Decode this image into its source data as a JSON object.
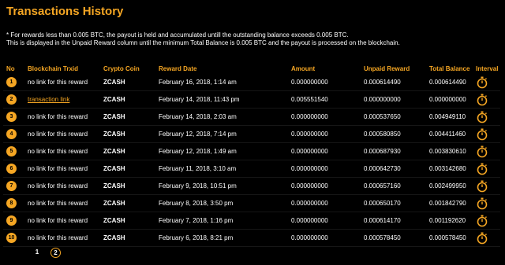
{
  "title": "Transactions History",
  "note": {
    "line1": "* For rewards less than 0.005 BTC, the payout is held and accumulated untill the outstanding balance exceeds 0.005 BTC.",
    "line2": "This is displayed in the Unpaid Reward column until the minimum Total Balance is 0.005 BTC and the payout is processed on the blockchain."
  },
  "columns": [
    "No",
    "Blockchain Trxid",
    "Crypto Coin",
    "Reward Date",
    "Amount",
    "Unpaid Reward",
    "Total Balance",
    "Interval"
  ],
  "rows": [
    {
      "no": "1",
      "trxid": "no link for this reward",
      "is_link": false,
      "coin": "ZCASH",
      "date": "February 16, 2018, 1:14 am",
      "amount": "0.000000000",
      "unpaid": "0.000614490",
      "total": "0.000614490"
    },
    {
      "no": "2",
      "trxid": "transaction link",
      "is_link": true,
      "coin": "ZCASH",
      "date": "February 14, 2018, 11:43 pm",
      "amount": "0.005551540",
      "unpaid": "0.000000000",
      "total": "0.000000000"
    },
    {
      "no": "3",
      "trxid": "no link for this reward",
      "is_link": false,
      "coin": "ZCASH",
      "date": "February 14, 2018, 2:03 am",
      "amount": "0.000000000",
      "unpaid": "0.000537650",
      "total": "0.004949110"
    },
    {
      "no": "4",
      "trxid": "no link for this reward",
      "is_link": false,
      "coin": "ZCASH",
      "date": "February 12, 2018, 7:14 pm",
      "amount": "0.000000000",
      "unpaid": "0.000580850",
      "total": "0.004411460"
    },
    {
      "no": "5",
      "trxid": "no link for this reward",
      "is_link": false,
      "coin": "ZCASH",
      "date": "February 12, 2018, 1:49 am",
      "amount": "0.000000000",
      "unpaid": "0.000687930",
      "total": "0.003830610"
    },
    {
      "no": "6",
      "trxid": "no link for this reward",
      "is_link": false,
      "coin": "ZCASH",
      "date": "February 11, 2018, 3:10 am",
      "amount": "0.000000000",
      "unpaid": "0.000642730",
      "total": "0.003142680"
    },
    {
      "no": "7",
      "trxid": "no link for this reward",
      "is_link": false,
      "coin": "ZCASH",
      "date": "February 9, 2018, 10:51 pm",
      "amount": "0.000000000",
      "unpaid": "0.000657160",
      "total": "0.002499950"
    },
    {
      "no": "8",
      "trxid": "no link for this reward",
      "is_link": false,
      "coin": "ZCASH",
      "date": "February 8, 2018, 3:50 pm",
      "amount": "0.000000000",
      "unpaid": "0.000650170",
      "total": "0.001842790"
    },
    {
      "no": "9",
      "trxid": "no link for this reward",
      "is_link": false,
      "coin": "ZCASH",
      "date": "February 7, 2018, 1:16 pm",
      "amount": "0.000000000",
      "unpaid": "0.000614170",
      "total": "0.001192620"
    },
    {
      "no": "10",
      "trxid": "no link for this reward",
      "is_link": false,
      "coin": "ZCASH",
      "date": "February 6, 2018, 8:21 pm",
      "amount": "0.000000000",
      "unpaid": "0.000578450",
      "total": "0.000578450"
    }
  ],
  "interval_icon": "stopwatch-icon",
  "pagination": {
    "pages": [
      "1",
      "2"
    ],
    "current": "2"
  },
  "colors": {
    "accent": "#f5a623",
    "background": "#000000",
    "text": "#ffffff"
  }
}
